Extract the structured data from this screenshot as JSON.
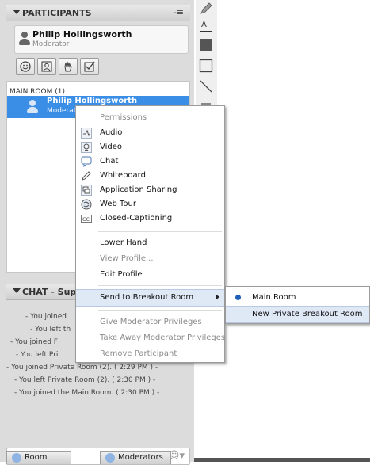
{
  "participants": {
    "title": "PARTICIPANTS",
    "menu_icon": "-≡",
    "presenter": {
      "name": "Philip Hollingsworth",
      "role": "Moderator"
    },
    "tool_buttons": [
      "status-icon",
      "profile-icon",
      "raise-hand-icon",
      "checkbox-icon"
    ],
    "main_room_label": "MAIN ROOM (1)",
    "selected_participant": {
      "name": "Philip Hollingsworth",
      "role": "Moderator"
    }
  },
  "chat": {
    "title": "CHAT - Sup",
    "messages": [
      "- You joined",
      "- You left th",
      "- You joined F",
      "- You left Pri",
      "- You joined Private Room (2). ( 2:29 PM ) -",
      "- You left Private Room (2). ( 2:30 PM ) -",
      "- You joined the Main Room. ( 2:30 PM ) -"
    ]
  },
  "tabs": {
    "room": "Room",
    "moderators": "Moderators"
  },
  "context_menu": {
    "permissions_header": "Permissions",
    "permissions": [
      {
        "label": "Audio",
        "icon": "audio-icon"
      },
      {
        "label": "Video",
        "icon": "video-icon"
      },
      {
        "label": "Chat",
        "icon": "chat-icon"
      },
      {
        "label": "Whiteboard",
        "icon": "pencil-icon"
      },
      {
        "label": "Application Sharing",
        "icon": "app-share-icon"
      },
      {
        "label": "Web Tour",
        "icon": "web-tour-icon"
      },
      {
        "label": "Closed-Captioning",
        "icon": "cc-icon"
      }
    ],
    "lower_hand": "Lower Hand",
    "view_profile": "View Profile...",
    "edit_profile": "Edit Profile",
    "send_to_breakout": "Send to Breakout Room",
    "give_moderator": "Give Moderator Privileges",
    "take_moderator": "Take Away Moderator Privileges",
    "remove_participant": "Remove Participant"
  },
  "submenu": {
    "main_room": "Main Room",
    "new_private": "New Private Breakout Room"
  }
}
